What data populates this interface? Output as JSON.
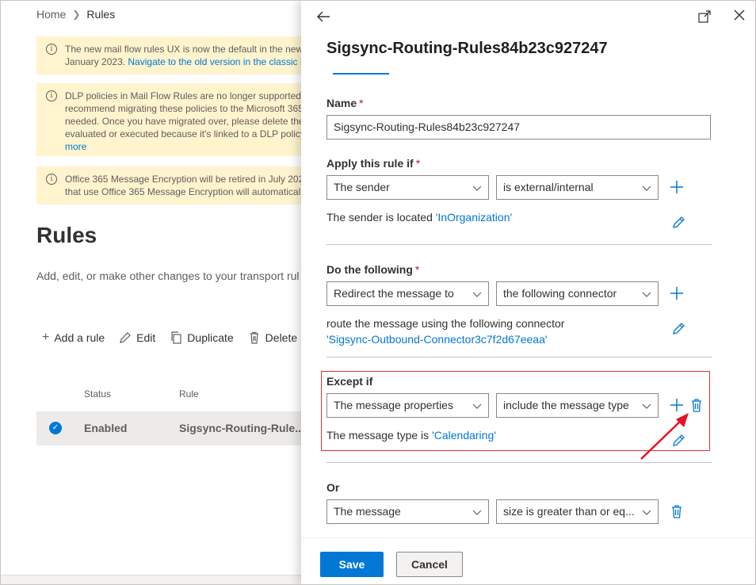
{
  "background": {
    "breadcrumb": {
      "home": "Home",
      "current": "Rules"
    },
    "notices": [
      {
        "lines": [
          "The new mail flow rules UX is now the default in the new",
          "January 2023. "
        ],
        "link": "Navigate to the old version in the classic E"
      },
      {
        "lines": [
          "DLP policies in Mail Flow Rules are no longer supported,",
          "recommend migrating these policies to the Microsoft 365",
          "needed. Once you have migrated over, please delete the",
          "evaluated or executed because it's linked to a DLP policy"
        ],
        "link": "more"
      },
      {
        "lines": [
          "Office 365 Message Encryption will be retired in July 2023",
          "that use Office 365 Message Encryption will automatically"
        ],
        "link": ""
      }
    ],
    "title": "Rules",
    "subtitle": "Add, edit, or make other changes to your transport rul",
    "commands": {
      "add": "Add a rule",
      "edit": "Edit",
      "duplicate": "Duplicate",
      "delete": "Delete"
    },
    "columns": {
      "status": "Status",
      "rule": "Rule"
    },
    "row": {
      "status": "Enabled",
      "rule": "Sigsync-Routing-Rule..."
    }
  },
  "panel": {
    "title": "Sigsync-Routing-Rules84b23c927247",
    "name_label": "Name",
    "required_mark": "*",
    "name_value": "Sigsync-Routing-Rules84b23c927247",
    "apply_label": "Apply this rule if",
    "apply": {
      "first": "The sender",
      "second": "is external/internal",
      "desc_prefix": "The sender is located ",
      "desc_value": "'InOrganization'"
    },
    "do_label": "Do the following",
    "do": {
      "first": "Redirect the message to",
      "second": "the following connector",
      "desc_prefix": "route the message using the following connector",
      "desc_value": "'Sigsync-Outbound-Connector3c7f2d67eeaa'"
    },
    "except_label": "Except if",
    "except": {
      "first": "The message properties",
      "second": "include the message type",
      "desc_prefix": "The message type is ",
      "desc_value": "'Calendaring'"
    },
    "or_label": "Or",
    "or": {
      "first": "The message",
      "second": "size is greater than or eq..."
    },
    "save_label": "Save",
    "cancel_label": "Cancel"
  },
  "colors": {
    "accent": "#0078d4",
    "highlight": "#d13438",
    "notice": "#fff4ce"
  }
}
